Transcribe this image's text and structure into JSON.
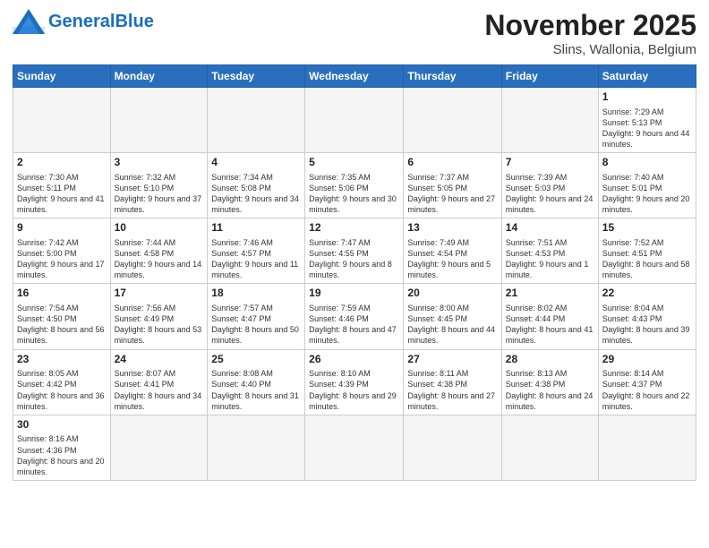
{
  "header": {
    "logo_general": "General",
    "logo_blue": "Blue",
    "title": "November 2025",
    "subtitle": "Slins, Wallonia, Belgium"
  },
  "days_of_week": [
    "Sunday",
    "Monday",
    "Tuesday",
    "Wednesday",
    "Thursday",
    "Friday",
    "Saturday"
  ],
  "weeks": [
    [
      {
        "day": "",
        "info": ""
      },
      {
        "day": "",
        "info": ""
      },
      {
        "day": "",
        "info": ""
      },
      {
        "day": "",
        "info": ""
      },
      {
        "day": "",
        "info": ""
      },
      {
        "day": "",
        "info": ""
      },
      {
        "day": "1",
        "info": "Sunrise: 7:29 AM\nSunset: 5:13 PM\nDaylight: 9 hours and 44 minutes."
      }
    ],
    [
      {
        "day": "2",
        "info": "Sunrise: 7:30 AM\nSunset: 5:11 PM\nDaylight: 9 hours and 41 minutes."
      },
      {
        "day": "3",
        "info": "Sunrise: 7:32 AM\nSunset: 5:10 PM\nDaylight: 9 hours and 37 minutes."
      },
      {
        "day": "4",
        "info": "Sunrise: 7:34 AM\nSunset: 5:08 PM\nDaylight: 9 hours and 34 minutes."
      },
      {
        "day": "5",
        "info": "Sunrise: 7:35 AM\nSunset: 5:06 PM\nDaylight: 9 hours and 30 minutes."
      },
      {
        "day": "6",
        "info": "Sunrise: 7:37 AM\nSunset: 5:05 PM\nDaylight: 9 hours and 27 minutes."
      },
      {
        "day": "7",
        "info": "Sunrise: 7:39 AM\nSunset: 5:03 PM\nDaylight: 9 hours and 24 minutes."
      },
      {
        "day": "8",
        "info": "Sunrise: 7:40 AM\nSunset: 5:01 PM\nDaylight: 9 hours and 20 minutes."
      }
    ],
    [
      {
        "day": "9",
        "info": "Sunrise: 7:42 AM\nSunset: 5:00 PM\nDaylight: 9 hours and 17 minutes."
      },
      {
        "day": "10",
        "info": "Sunrise: 7:44 AM\nSunset: 4:58 PM\nDaylight: 9 hours and 14 minutes."
      },
      {
        "day": "11",
        "info": "Sunrise: 7:46 AM\nSunset: 4:57 PM\nDaylight: 9 hours and 11 minutes."
      },
      {
        "day": "12",
        "info": "Sunrise: 7:47 AM\nSunset: 4:55 PM\nDaylight: 9 hours and 8 minutes."
      },
      {
        "day": "13",
        "info": "Sunrise: 7:49 AM\nSunset: 4:54 PM\nDaylight: 9 hours and 5 minutes."
      },
      {
        "day": "14",
        "info": "Sunrise: 7:51 AM\nSunset: 4:53 PM\nDaylight: 9 hours and 1 minute."
      },
      {
        "day": "15",
        "info": "Sunrise: 7:52 AM\nSunset: 4:51 PM\nDaylight: 8 hours and 58 minutes."
      }
    ],
    [
      {
        "day": "16",
        "info": "Sunrise: 7:54 AM\nSunset: 4:50 PM\nDaylight: 8 hours and 56 minutes."
      },
      {
        "day": "17",
        "info": "Sunrise: 7:56 AM\nSunset: 4:49 PM\nDaylight: 8 hours and 53 minutes."
      },
      {
        "day": "18",
        "info": "Sunrise: 7:57 AM\nSunset: 4:47 PM\nDaylight: 8 hours and 50 minutes."
      },
      {
        "day": "19",
        "info": "Sunrise: 7:59 AM\nSunset: 4:46 PM\nDaylight: 8 hours and 47 minutes."
      },
      {
        "day": "20",
        "info": "Sunrise: 8:00 AM\nSunset: 4:45 PM\nDaylight: 8 hours and 44 minutes."
      },
      {
        "day": "21",
        "info": "Sunrise: 8:02 AM\nSunset: 4:44 PM\nDaylight: 8 hours and 41 minutes."
      },
      {
        "day": "22",
        "info": "Sunrise: 8:04 AM\nSunset: 4:43 PM\nDaylight: 8 hours and 39 minutes."
      }
    ],
    [
      {
        "day": "23",
        "info": "Sunrise: 8:05 AM\nSunset: 4:42 PM\nDaylight: 8 hours and 36 minutes."
      },
      {
        "day": "24",
        "info": "Sunrise: 8:07 AM\nSunset: 4:41 PM\nDaylight: 8 hours and 34 minutes."
      },
      {
        "day": "25",
        "info": "Sunrise: 8:08 AM\nSunset: 4:40 PM\nDaylight: 8 hours and 31 minutes."
      },
      {
        "day": "26",
        "info": "Sunrise: 8:10 AM\nSunset: 4:39 PM\nDaylight: 8 hours and 29 minutes."
      },
      {
        "day": "27",
        "info": "Sunrise: 8:11 AM\nSunset: 4:38 PM\nDaylight: 8 hours and 27 minutes."
      },
      {
        "day": "28",
        "info": "Sunrise: 8:13 AM\nSunset: 4:38 PM\nDaylight: 8 hours and 24 minutes."
      },
      {
        "day": "29",
        "info": "Sunrise: 8:14 AM\nSunset: 4:37 PM\nDaylight: 8 hours and 22 minutes."
      }
    ],
    [
      {
        "day": "30",
        "info": "Sunrise: 8:16 AM\nSunset: 4:36 PM\nDaylight: 8 hours and 20 minutes."
      },
      {
        "day": "",
        "info": ""
      },
      {
        "day": "",
        "info": ""
      },
      {
        "day": "",
        "info": ""
      },
      {
        "day": "",
        "info": ""
      },
      {
        "day": "",
        "info": ""
      },
      {
        "day": "",
        "info": ""
      }
    ]
  ]
}
